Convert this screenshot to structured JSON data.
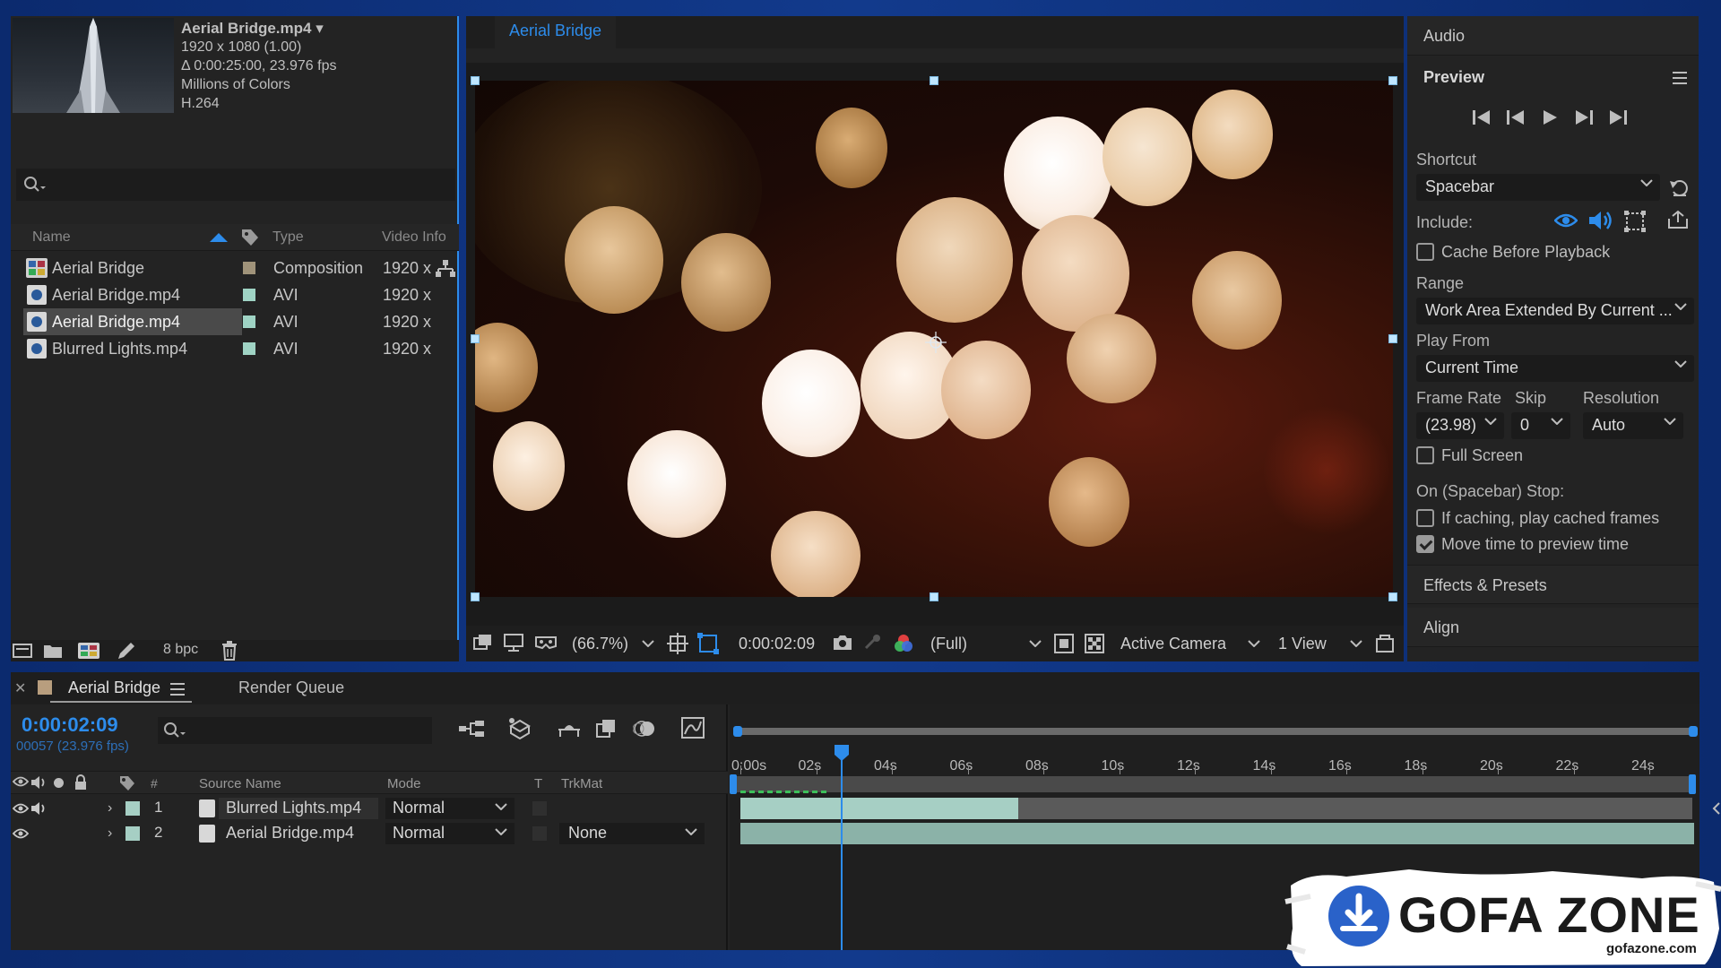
{
  "project": {
    "item_title": "Aerial Bridge.mp4",
    "item_title_arrow": "▾",
    "meta": [
      "1920 x 1080 (1.00)",
      "Δ 0:00:25:00, 23.976 fps",
      "Millions of Colors",
      "H.264"
    ],
    "columns": {
      "name": "Name",
      "type": "Type",
      "video_info": "Video Info"
    },
    "rows": [
      {
        "name": "Aerial Bridge",
        "type": "Composition",
        "video_info": "1920 x",
        "label_color": "#a0937a",
        "kind": "composition",
        "selected": false
      },
      {
        "name": "Aerial Bridge.mp4",
        "type": "AVI",
        "video_info": "1920 x",
        "label_color": "#9fd3c4",
        "kind": "footage",
        "selected": false
      },
      {
        "name": "Aerial Bridge.mp4",
        "type": "AVI",
        "video_info": "1920 x",
        "label_color": "#9fd3c4",
        "kind": "footage",
        "selected": true
      },
      {
        "name": "Blurred Lights.mp4",
        "type": "AVI",
        "video_info": "1920 x",
        "label_color": "#9fd3c4",
        "kind": "footage",
        "selected": false
      }
    ],
    "bit_depth": "8 bpc"
  },
  "viewer": {
    "tab_label": "Aerial Bridge",
    "zoom": "(66.7%)",
    "timecode": "0:00:02:09",
    "resolution": "(Full)",
    "camera": "Active Camera",
    "view": "1 View"
  },
  "right_panel": {
    "audio": "Audio",
    "preview": "Preview",
    "shortcut_label": "Shortcut",
    "shortcut_value": "Spacebar",
    "include_label": "Include:",
    "cache_before_playback": "Cache Before Playback",
    "range_label": "Range",
    "range_value": "Work Area Extended By Current ...",
    "play_from_label": "Play From",
    "play_from_value": "Current Time",
    "frame_rate_label": "Frame Rate",
    "skip_label": "Skip",
    "resolution_label": "Resolution",
    "frame_rate_value": "(23.98)",
    "skip_value": "0",
    "resolution_value": "Auto",
    "full_screen": "Full Screen",
    "on_stop_label": "On (Spacebar) Stop:",
    "if_caching": "If caching, play cached frames",
    "move_time": "Move time to preview time",
    "effects_presets": "Effects & Presets",
    "align": "Align"
  },
  "timeline": {
    "tab_label": "Aerial Bridge",
    "render_queue": "Render Queue",
    "current_time": "0:00:02:09",
    "frame_info": "00057 (23.976 fps)",
    "columns": {
      "hash": "#",
      "source_name": "Source Name",
      "mode": "Mode",
      "t": "T",
      "trkmat": "TrkMat"
    },
    "layers": [
      {
        "num": "1",
        "name": "Blurred Lights.mp4",
        "mode": "Normal",
        "trkmat": ""
      },
      {
        "num": "2",
        "name": "Aerial Bridge.mp4",
        "mode": "Normal",
        "trkmat": "None"
      }
    ],
    "ticks": [
      "0:00s",
      "02s",
      "04s",
      "06s",
      "08s",
      "10s",
      "12s",
      "14s",
      "16s",
      "18s",
      "20s",
      "22s",
      "24s"
    ]
  },
  "watermark": {
    "brand": "GOFA ZONE",
    "url": "gofazone.com"
  },
  "colors": {
    "accent": "#2d8ceb",
    "panel": "#232323",
    "clip_teal": "#a6cfc4"
  }
}
